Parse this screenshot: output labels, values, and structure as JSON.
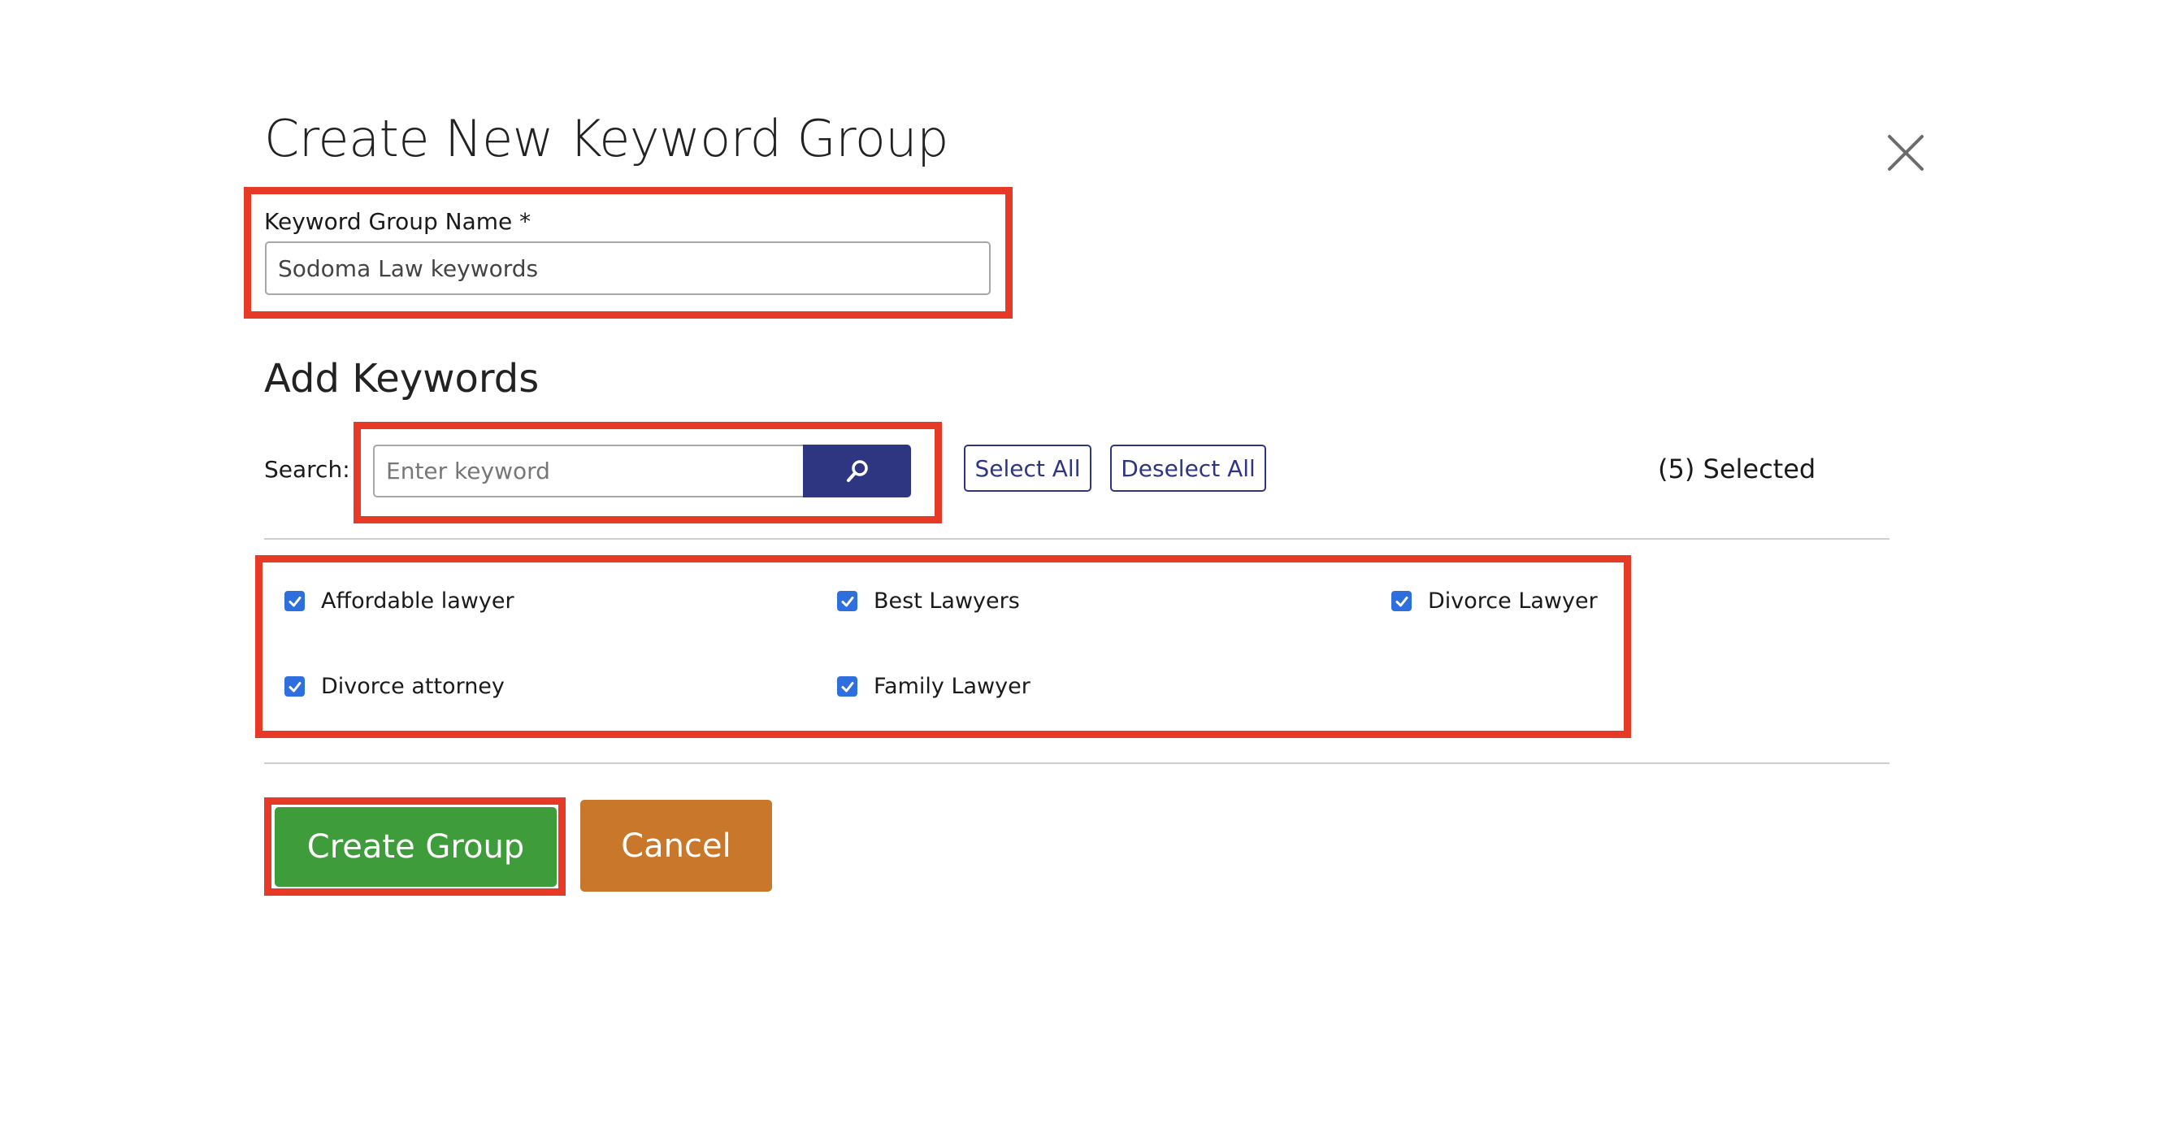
{
  "modal": {
    "title": "Create New Keyword Group",
    "close_icon": "close-icon"
  },
  "group_name": {
    "label": "Keyword Group Name *",
    "value": "Sodoma Law keywords"
  },
  "add_keywords": {
    "heading": "Add Keywords",
    "search_label": "Search:",
    "search_placeholder": "Enter keyword",
    "search_icon": "search-icon",
    "select_all_label": "Select All",
    "deselect_all_label": "Deselect All",
    "selected_count": "(5) Selected"
  },
  "keywords": [
    {
      "label": "Affordable lawyer",
      "checked": true
    },
    {
      "label": "Best Lawyers",
      "checked": true
    },
    {
      "label": "Divorce Lawyer",
      "checked": true
    },
    {
      "label": "Divorce attorney",
      "checked": true
    },
    {
      "label": "Family Lawyer",
      "checked": true
    }
  ],
  "actions": {
    "create_label": "Create Group",
    "cancel_label": "Cancel"
  },
  "colors": {
    "highlight": "#e63a26",
    "primary": "#2f3681",
    "create": "#3f9c3a",
    "cancel": "#c8772b",
    "checkbox": "#2f6fdd"
  }
}
